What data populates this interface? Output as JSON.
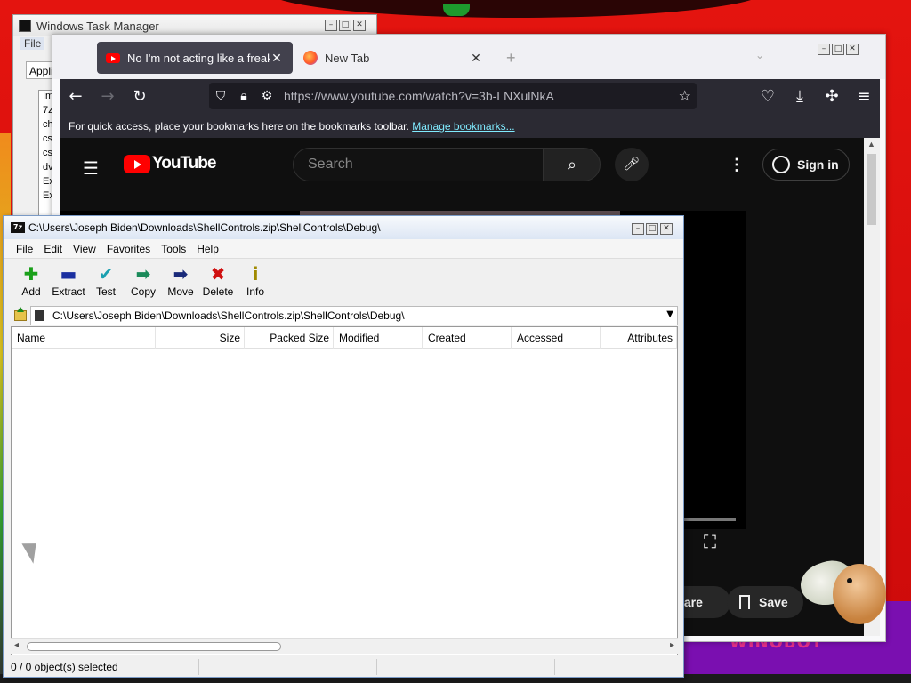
{
  "desktop": {
    "watermark_text": "WINOBOT"
  },
  "taskmanager": {
    "title": "Windows Task Manager",
    "menu_file": "File",
    "tab_applications": "Applic",
    "list_items": [
      "Im",
      "7z",
      "ch",
      "cs",
      "cs",
      "dv",
      "Ex",
      "Ex"
    ]
  },
  "firefox": {
    "tabs": [
      {
        "label": "No I'm not acting like a freak! -",
        "icon": "youtube-icon",
        "active": true
      },
      {
        "label": "New Tab",
        "icon": "firefox-icon",
        "active": false
      }
    ],
    "new_tab": "+",
    "url": "https://www.youtube.com/watch?v=3b-LNXulNkA",
    "bookmarks_bar_text": "For quick access, place your bookmarks here on the bookmarks toolbar.",
    "bookmarks_link": "Manage bookmarks..."
  },
  "youtube": {
    "logo_text": "YouTube",
    "search_placeholder": "Search",
    "signin": "Sign in",
    "share": "Share",
    "save": "Save"
  },
  "sevenzip": {
    "title": "C:\\Users\\Joseph Biden\\Downloads\\ShellControls.zip\\ShellControls\\Debug\\",
    "logo": "7z",
    "menu": [
      "File",
      "Edit",
      "View",
      "Favorites",
      "Tools",
      "Help"
    ],
    "toolbar": [
      {
        "label": "Add",
        "icon": "plus-icon",
        "color": "#1aa01a",
        "glyph": "✚"
      },
      {
        "label": "Extract",
        "icon": "minus-icon",
        "color": "#1a2fa0",
        "glyph": "▬"
      },
      {
        "label": "Test",
        "icon": "check-icon",
        "color": "#1aa0b0",
        "glyph": "✔"
      },
      {
        "label": "Copy",
        "icon": "copy-arrow-icon",
        "color": "#1a8a5a",
        "glyph": "➡"
      },
      {
        "label": "Move",
        "icon": "move-arrow-icon",
        "color": "#1a2a7a",
        "glyph": "➡"
      },
      {
        "label": "Delete",
        "icon": "delete-x-icon",
        "color": "#d01010",
        "glyph": "✖"
      },
      {
        "label": "Info",
        "icon": "info-icon",
        "color": "#a08a00",
        "glyph": "i"
      }
    ],
    "address": "C:\\Users\\Joseph Biden\\Downloads\\ShellControls.zip\\ShellControls\\Debug\\",
    "columns": [
      "Name",
      "Size",
      "Packed Size",
      "Modified",
      "Created",
      "Accessed",
      "Attributes"
    ],
    "status": "0 / 0 object(s) selected"
  }
}
